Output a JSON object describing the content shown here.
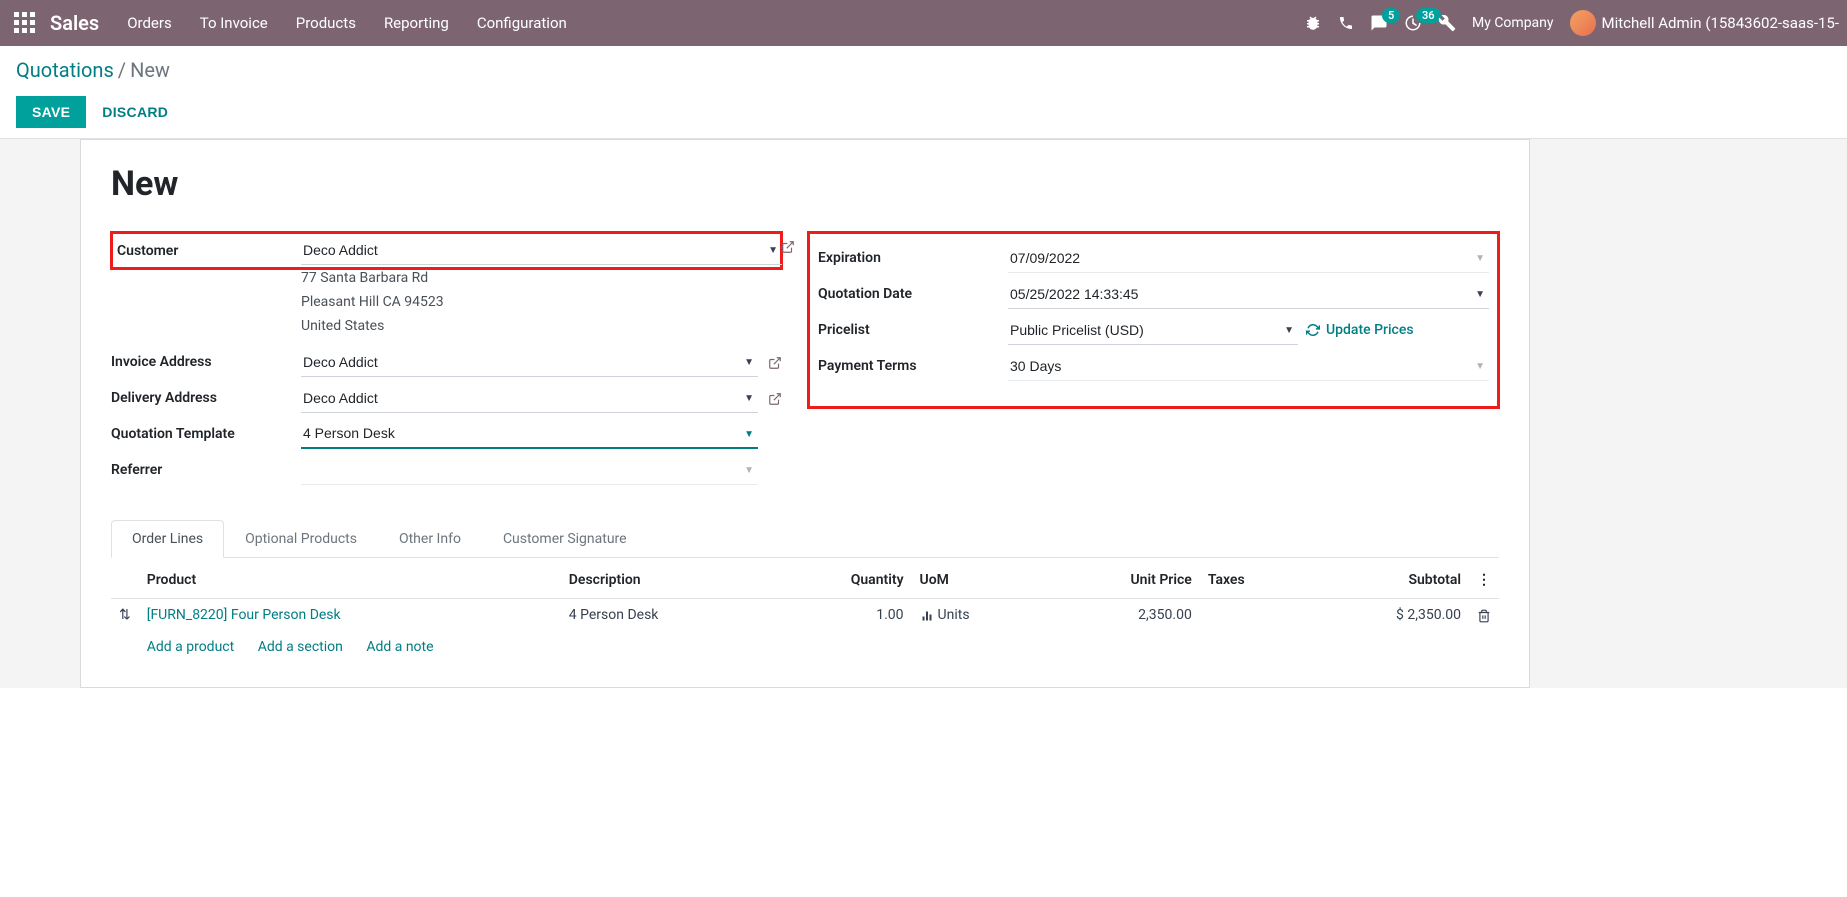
{
  "nav": {
    "brand": "Sales",
    "links": [
      "Orders",
      "To Invoice",
      "Products",
      "Reporting",
      "Configuration"
    ],
    "messages_badge": "5",
    "activities_badge": "36",
    "company": "My Company",
    "user": "Mitchell Admin (15843602-saas-15-"
  },
  "breadcrumb": {
    "root": "Quotations",
    "current": "New"
  },
  "buttons": {
    "save": "SAVE",
    "discard": "DISCARD"
  },
  "page": {
    "title": "New"
  },
  "left": {
    "customer_label": "Customer",
    "customer": "Deco Addict",
    "address1": "77 Santa Barbara Rd",
    "address2": "Pleasant Hill CA 94523",
    "address3": "United States",
    "invoice_address_label": "Invoice Address",
    "invoice_address": "Deco Addict",
    "delivery_address_label": "Delivery Address",
    "delivery_address": "Deco Addict",
    "quotation_template_label": "Quotation Template",
    "quotation_template": "4 Person Desk",
    "referrer_label": "Referrer",
    "referrer": ""
  },
  "right": {
    "expiration_label": "Expiration",
    "expiration": "07/09/2022",
    "quotation_date_label": "Quotation Date",
    "quotation_date": "05/25/2022 14:33:45",
    "pricelist_label": "Pricelist",
    "pricelist": "Public Pricelist (USD)",
    "update_prices": "Update Prices",
    "payment_terms_label": "Payment Terms",
    "payment_terms": "30 Days"
  },
  "tabs": [
    "Order Lines",
    "Optional Products",
    "Other Info",
    "Customer Signature"
  ],
  "table": {
    "headers": {
      "product": "Product",
      "description": "Description",
      "quantity": "Quantity",
      "uom": "UoM",
      "unit_price": "Unit Price",
      "taxes": "Taxes",
      "subtotal": "Subtotal"
    },
    "rows": [
      {
        "product": "[FURN_8220] Four Person Desk",
        "description": "4 Person Desk",
        "quantity": "1.00",
        "uom": "Units",
        "unit_price": "2,350.00",
        "taxes": "",
        "subtotal": "$ 2,350.00"
      }
    ],
    "add_product": "Add a product",
    "add_section": "Add a section",
    "add_note": "Add a note"
  }
}
